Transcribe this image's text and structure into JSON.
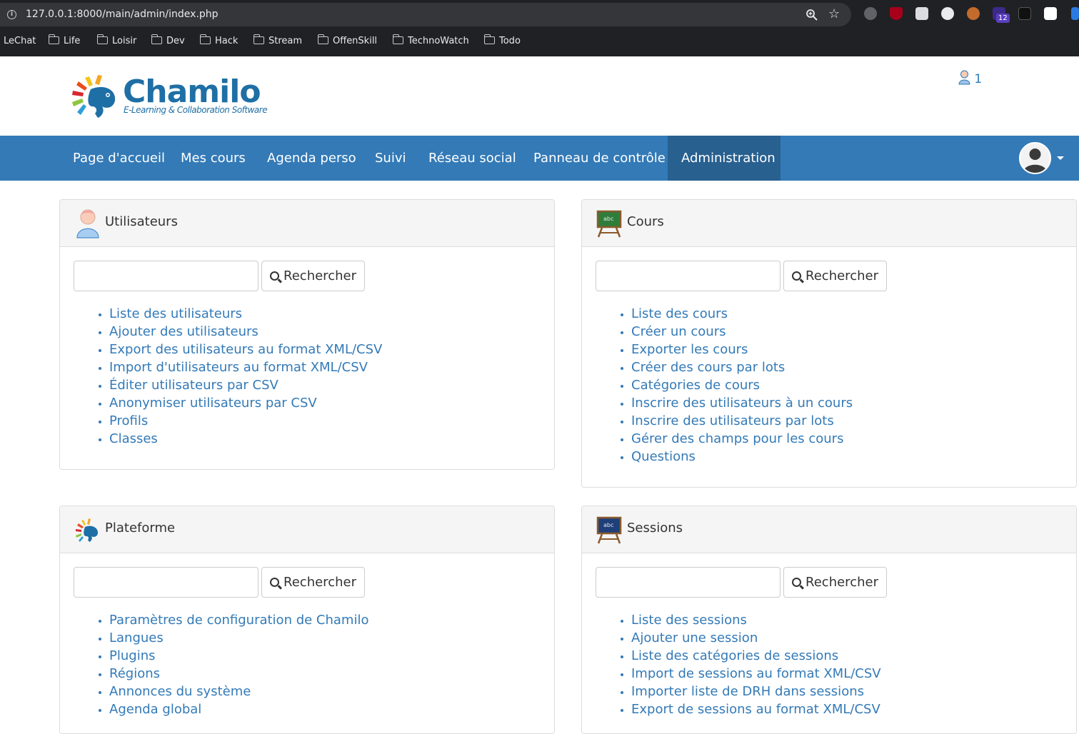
{
  "browser": {
    "url": "127.0.0.1:8000/main/admin/index.php",
    "extension_badge": "12",
    "bookmarks": [
      "LeChat",
      "Life",
      "Loisir",
      "Dev",
      "Hack",
      "Stream",
      "OffenSkill",
      "TechnoWatch",
      "Todo"
    ]
  },
  "header": {
    "logo_text": "Chamilo",
    "logo_tagline": "E-Learning & Collaboration Software",
    "online_count": "1"
  },
  "nav": {
    "items": [
      "Page d'accueil",
      "Mes cours",
      "Agenda perso",
      "Suivi",
      "Réseau social",
      "Panneau de contrôle",
      "Administration"
    ],
    "active": "Administration"
  },
  "panels": {
    "users": {
      "title": "Utilisateurs",
      "search_label": "Rechercher",
      "links": [
        "Liste des utilisateurs",
        "Ajouter des utilisateurs",
        "Export des utilisateurs au format XML/CSV",
        "Import d'utilisateurs au format XML/CSV",
        "Éditer utilisateurs par CSV",
        "Anonymiser utilisateurs par CSV",
        "Profils",
        "Classes"
      ]
    },
    "courses": {
      "title": "Cours",
      "search_label": "Rechercher",
      "links": [
        "Liste des cours",
        "Créer un cours",
        "Exporter les cours",
        "Créer des cours par lots",
        "Catégories de cours",
        "Inscrire des utilisateurs à un cours",
        "Inscrire des utilisateurs par lots",
        "Gérer des champs pour les cours",
        "Questions"
      ]
    },
    "platform": {
      "title": "Plateforme",
      "search_label": "Rechercher",
      "links": [
        "Paramètres de configuration de Chamilo",
        "Langues",
        "Plugins",
        "Régions",
        "Annonces du système",
        "Agenda global"
      ]
    },
    "sessions": {
      "title": "Sessions",
      "search_label": "Rechercher",
      "links": [
        "Liste des sessions",
        "Ajouter une session",
        "Liste des catégories de sessions",
        "Import de sessions au format XML/CSV",
        "Importer liste de DRH dans sessions",
        "Export de sessions au format XML/CSV"
      ]
    }
  },
  "colors": {
    "nav_bg": "#337ab7",
    "nav_active": "#286090",
    "link": "#337ab7"
  }
}
